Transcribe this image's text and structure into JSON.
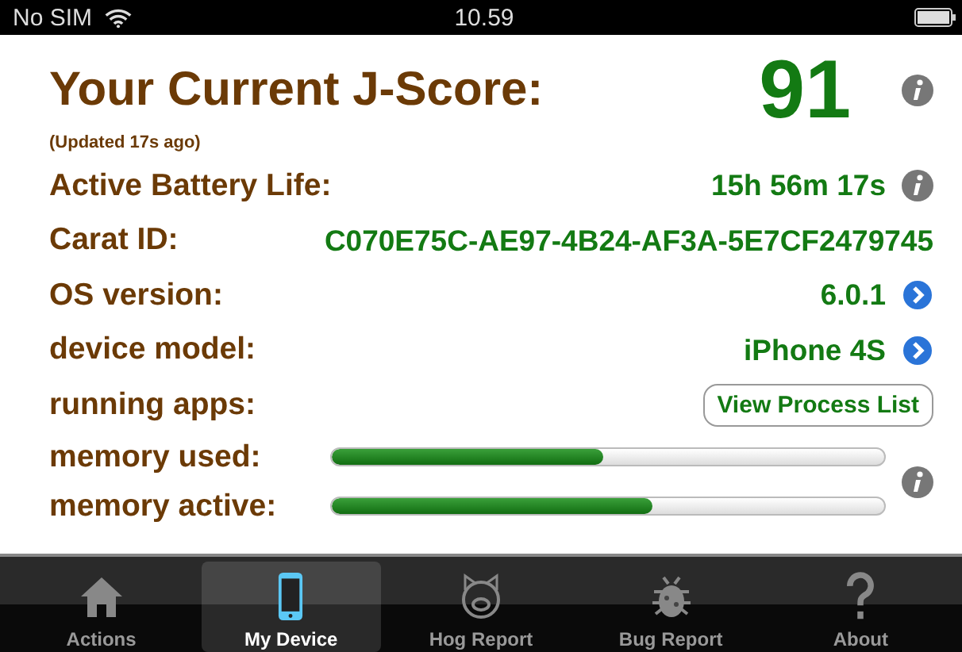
{
  "status_bar": {
    "carrier": "No SIM",
    "time": "10.59"
  },
  "score": {
    "title": "Your Current J-Score:",
    "value": "91",
    "updated": "(Updated 17s ago)"
  },
  "rows": [
    {
      "kind": "info",
      "label": "Active Battery Life:",
      "value": "15h 56m 17s"
    },
    {
      "kind": "plain",
      "label": "Carat ID:",
      "value": "C070E75C-AE97-4B24-AF3A-5E7CF2479745"
    },
    {
      "kind": "disclosure",
      "label": "OS version:",
      "value": "6.0.1"
    },
    {
      "kind": "disclosure",
      "label": "device model:",
      "value": "iPhone 4S"
    },
    {
      "kind": "button",
      "label": "running apps:",
      "value": "View Process List"
    }
  ],
  "memory": [
    {
      "label": "memory used:",
      "level": 0.49
    },
    {
      "label": "memory active:",
      "level": 0.58
    }
  ],
  "tabs": [
    {
      "label": "Actions",
      "selected": false
    },
    {
      "label": "My Device",
      "selected": true
    },
    {
      "label": "Hog Report",
      "selected": false
    },
    {
      "label": "Bug Report",
      "selected": false
    },
    {
      "label": "About",
      "selected": false
    }
  ]
}
